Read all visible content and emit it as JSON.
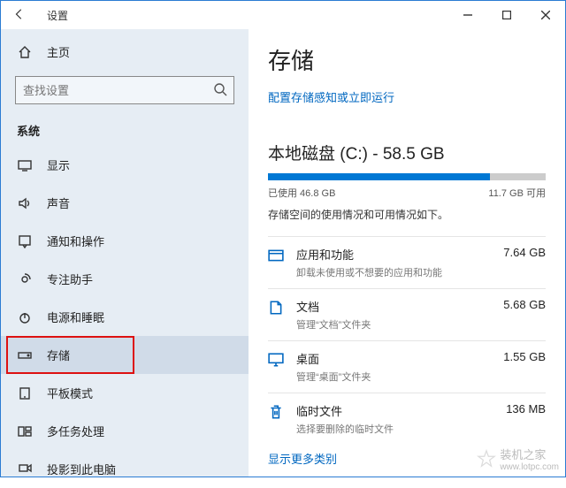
{
  "window": {
    "title": "设置"
  },
  "sidebar": {
    "home": "主页",
    "search_placeholder": "查找设置",
    "section": "系统",
    "items": [
      {
        "label": "显示"
      },
      {
        "label": "声音"
      },
      {
        "label": "通知和操作"
      },
      {
        "label": "专注助手"
      },
      {
        "label": "电源和睡眠"
      },
      {
        "label": "存储"
      },
      {
        "label": "平板模式"
      },
      {
        "label": "多任务处理"
      },
      {
        "label": "投影到此电脑"
      }
    ]
  },
  "main": {
    "title": "存储",
    "config_link": "配置存储感知或立即运行",
    "disk_title": "本地磁盘 (C:) - 58.5 GB",
    "used_label": "已使用 46.8 GB",
    "free_label": "11.7 GB 可用",
    "used_percent": 80,
    "desc": "存储空间的使用情况和可用情况如下。",
    "categories": [
      {
        "name": "应用和功能",
        "size": "7.64 GB",
        "sub": "卸载未使用或不想要的应用和功能"
      },
      {
        "name": "文档",
        "size": "5.68 GB",
        "sub": "管理“文档”文件夹"
      },
      {
        "name": "桌面",
        "size": "1.55 GB",
        "sub": "管理“桌面”文件夹"
      },
      {
        "name": "临时文件",
        "size": "136 MB",
        "sub": "选择要删除的临时文件"
      }
    ],
    "more": "显示更多类别"
  },
  "watermark": {
    "brand": "装机之家",
    "url": "www.lotpc.com"
  }
}
